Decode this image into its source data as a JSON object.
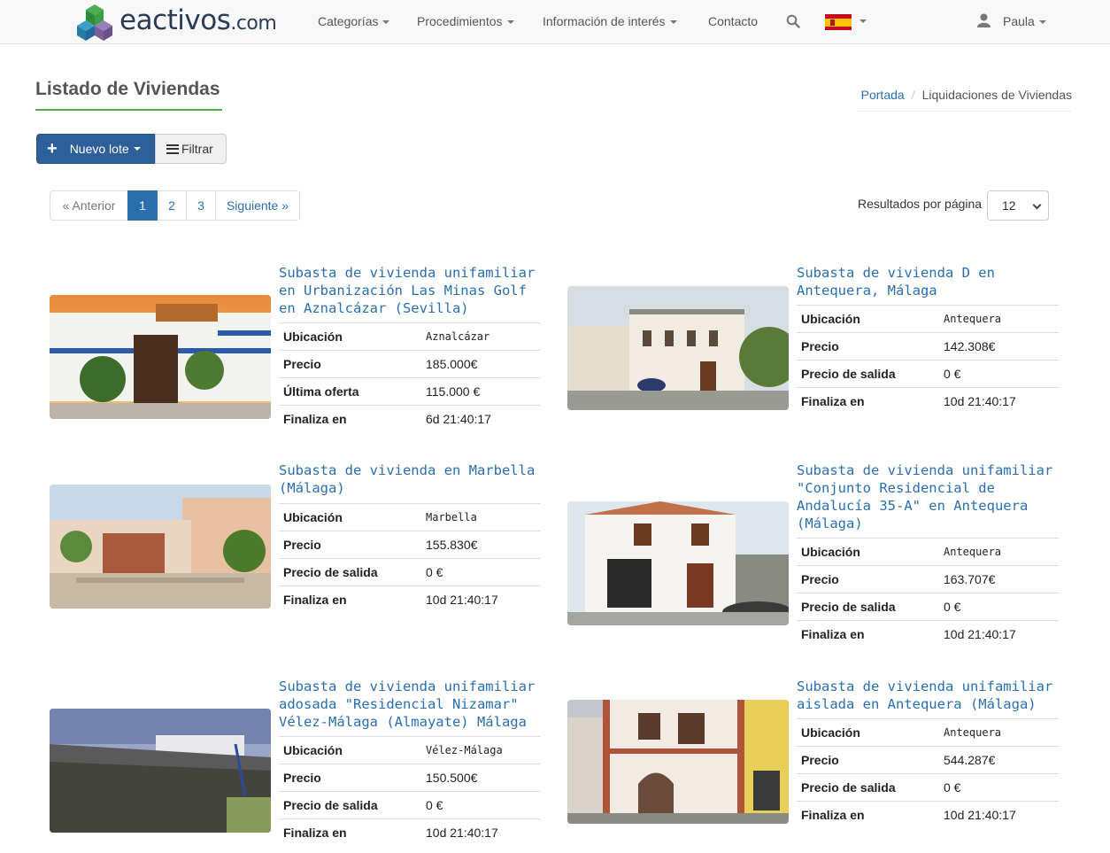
{
  "nav": {
    "logo_text": "eactivos",
    "logo_domain": ".com",
    "items": [
      "Categorías",
      "Procedimientos",
      "Información de interés",
      "Contacto"
    ],
    "language": "es",
    "user": "Paula"
  },
  "page": {
    "title": "Listado de Viviendas",
    "breadcrumb": [
      "Portada",
      "Liquidaciones de Viviendas"
    ]
  },
  "toolbar": {
    "new_lot_label": "Nuevo lote",
    "filter_label": "Filtrar"
  },
  "pagination": {
    "prev": "« Anterior",
    "pages": [
      "1",
      "2",
      "3"
    ],
    "active": "1",
    "next": "Siguiente »",
    "results_label": "Resultados por página",
    "per_page": "12"
  },
  "listings": [
    {
      "title": "Subasta de vivienda unifamiliar en Urbanización Las Minas Golf en Aznalcázar (Sevilla)",
      "rows": [
        {
          "k": "Ubicación",
          "v": "Aznalcázar"
        },
        {
          "k": "Precio",
          "v": "185.000€"
        },
        {
          "k": "Última oferta",
          "v": "115.000 €"
        },
        {
          "k": "Finaliza en",
          "v": "6d 21:40:17"
        }
      ]
    },
    {
      "title": "Subasta de vivienda D en Antequera, Málaga",
      "rows": [
        {
          "k": "Ubicación",
          "v": "Antequera"
        },
        {
          "k": "Precio",
          "v": "142.308€"
        },
        {
          "k": "Precio de salida",
          "v": "0 €"
        },
        {
          "k": "Finaliza en",
          "v": "10d 21:40:17"
        }
      ]
    },
    {
      "title": "Subasta de vivienda en Marbella (Málaga)",
      "rows": [
        {
          "k": "Ubicación",
          "v": "Marbella"
        },
        {
          "k": "Precio",
          "v": "155.830€"
        },
        {
          "k": "Precio de salida",
          "v": "0 €"
        },
        {
          "k": "Finaliza en",
          "v": "10d 21:40:17"
        }
      ]
    },
    {
      "title": "Subasta de vivienda unifamiliar \"Conjunto Residencial de Andalucía 35-A\" en Antequera (Málaga)",
      "rows": [
        {
          "k": "Ubicación",
          "v": "Antequera"
        },
        {
          "k": "Precio",
          "v": "163.707€"
        },
        {
          "k": "Precio de salida",
          "v": "0 €"
        },
        {
          "k": "Finaliza en",
          "v": "10d 21:40:17"
        }
      ]
    },
    {
      "title": "Subasta de vivienda unifamiliar adosada \"Residencial Nizamar\" Vélez-Málaga (Almayate) Málaga",
      "rows": [
        {
          "k": "Ubicación",
          "v": "Vélez-Málaga"
        },
        {
          "k": "Precio",
          "v": "150.500€"
        },
        {
          "k": "Precio de salida",
          "v": "0 €"
        },
        {
          "k": "Finaliza en",
          "v": "10d 21:40:17"
        }
      ]
    },
    {
      "title": "Subasta de vivienda unifamiliar aislada en Antequera (Málaga)",
      "rows": [
        {
          "k": "Ubicación",
          "v": "Antequera"
        },
        {
          "k": "Precio",
          "v": "544.287€"
        },
        {
          "k": "Precio de salida",
          "v": "0 €"
        },
        {
          "k": "Finaliza en",
          "v": "10d 21:40:17"
        }
      ]
    }
  ]
}
